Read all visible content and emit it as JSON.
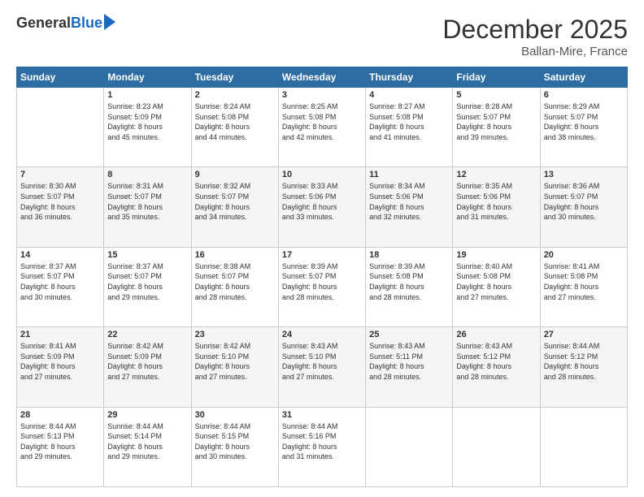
{
  "header": {
    "logo_general": "General",
    "logo_blue": "Blue",
    "month_title": "December 2025",
    "location": "Ballan-Mire, France"
  },
  "days_of_week": [
    "Sunday",
    "Monday",
    "Tuesday",
    "Wednesday",
    "Thursday",
    "Friday",
    "Saturday"
  ],
  "weeks": [
    [
      {
        "day": "",
        "content": ""
      },
      {
        "day": "1",
        "content": "Sunrise: 8:23 AM\nSunset: 5:09 PM\nDaylight: 8 hours\nand 45 minutes."
      },
      {
        "day": "2",
        "content": "Sunrise: 8:24 AM\nSunset: 5:08 PM\nDaylight: 8 hours\nand 44 minutes."
      },
      {
        "day": "3",
        "content": "Sunrise: 8:25 AM\nSunset: 5:08 PM\nDaylight: 8 hours\nand 42 minutes."
      },
      {
        "day": "4",
        "content": "Sunrise: 8:27 AM\nSunset: 5:08 PM\nDaylight: 8 hours\nand 41 minutes."
      },
      {
        "day": "5",
        "content": "Sunrise: 8:28 AM\nSunset: 5:07 PM\nDaylight: 8 hours\nand 39 minutes."
      },
      {
        "day": "6",
        "content": "Sunrise: 8:29 AM\nSunset: 5:07 PM\nDaylight: 8 hours\nand 38 minutes."
      }
    ],
    [
      {
        "day": "7",
        "content": "Sunrise: 8:30 AM\nSunset: 5:07 PM\nDaylight: 8 hours\nand 36 minutes."
      },
      {
        "day": "8",
        "content": "Sunrise: 8:31 AM\nSunset: 5:07 PM\nDaylight: 8 hours\nand 35 minutes."
      },
      {
        "day": "9",
        "content": "Sunrise: 8:32 AM\nSunset: 5:07 PM\nDaylight: 8 hours\nand 34 minutes."
      },
      {
        "day": "10",
        "content": "Sunrise: 8:33 AM\nSunset: 5:06 PM\nDaylight: 8 hours\nand 33 minutes."
      },
      {
        "day": "11",
        "content": "Sunrise: 8:34 AM\nSunset: 5:06 PM\nDaylight: 8 hours\nand 32 minutes."
      },
      {
        "day": "12",
        "content": "Sunrise: 8:35 AM\nSunset: 5:06 PM\nDaylight: 8 hours\nand 31 minutes."
      },
      {
        "day": "13",
        "content": "Sunrise: 8:36 AM\nSunset: 5:07 PM\nDaylight: 8 hours\nand 30 minutes."
      }
    ],
    [
      {
        "day": "14",
        "content": "Sunrise: 8:37 AM\nSunset: 5:07 PM\nDaylight: 8 hours\nand 30 minutes."
      },
      {
        "day": "15",
        "content": "Sunrise: 8:37 AM\nSunset: 5:07 PM\nDaylight: 8 hours\nand 29 minutes."
      },
      {
        "day": "16",
        "content": "Sunrise: 8:38 AM\nSunset: 5:07 PM\nDaylight: 8 hours\nand 28 minutes."
      },
      {
        "day": "17",
        "content": "Sunrise: 8:39 AM\nSunset: 5:07 PM\nDaylight: 8 hours\nand 28 minutes."
      },
      {
        "day": "18",
        "content": "Sunrise: 8:39 AM\nSunset: 5:08 PM\nDaylight: 8 hours\nand 28 minutes."
      },
      {
        "day": "19",
        "content": "Sunrise: 8:40 AM\nSunset: 5:08 PM\nDaylight: 8 hours\nand 27 minutes."
      },
      {
        "day": "20",
        "content": "Sunrise: 8:41 AM\nSunset: 5:08 PM\nDaylight: 8 hours\nand 27 minutes."
      }
    ],
    [
      {
        "day": "21",
        "content": "Sunrise: 8:41 AM\nSunset: 5:09 PM\nDaylight: 8 hours\nand 27 minutes."
      },
      {
        "day": "22",
        "content": "Sunrise: 8:42 AM\nSunset: 5:09 PM\nDaylight: 8 hours\nand 27 minutes."
      },
      {
        "day": "23",
        "content": "Sunrise: 8:42 AM\nSunset: 5:10 PM\nDaylight: 8 hours\nand 27 minutes."
      },
      {
        "day": "24",
        "content": "Sunrise: 8:43 AM\nSunset: 5:10 PM\nDaylight: 8 hours\nand 27 minutes."
      },
      {
        "day": "25",
        "content": "Sunrise: 8:43 AM\nSunset: 5:11 PM\nDaylight: 8 hours\nand 28 minutes."
      },
      {
        "day": "26",
        "content": "Sunrise: 8:43 AM\nSunset: 5:12 PM\nDaylight: 8 hours\nand 28 minutes."
      },
      {
        "day": "27",
        "content": "Sunrise: 8:44 AM\nSunset: 5:12 PM\nDaylight: 8 hours\nand 28 minutes."
      }
    ],
    [
      {
        "day": "28",
        "content": "Sunrise: 8:44 AM\nSunset: 5:13 PM\nDaylight: 8 hours\nand 29 minutes."
      },
      {
        "day": "29",
        "content": "Sunrise: 8:44 AM\nSunset: 5:14 PM\nDaylight: 8 hours\nand 29 minutes."
      },
      {
        "day": "30",
        "content": "Sunrise: 8:44 AM\nSunset: 5:15 PM\nDaylight: 8 hours\nand 30 minutes."
      },
      {
        "day": "31",
        "content": "Sunrise: 8:44 AM\nSunset: 5:16 PM\nDaylight: 8 hours\nand 31 minutes."
      },
      {
        "day": "",
        "content": ""
      },
      {
        "day": "",
        "content": ""
      },
      {
        "day": "",
        "content": ""
      }
    ]
  ]
}
